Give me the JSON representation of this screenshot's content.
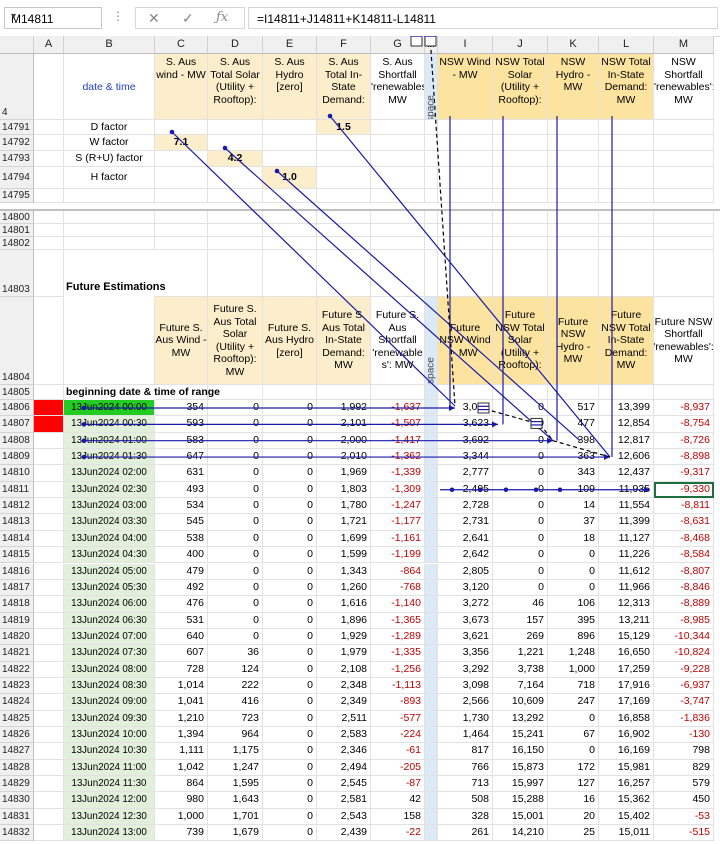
{
  "formula_bar": {
    "name_box": "M14811",
    "formula": "=I14811+J14811+K14811-L14811"
  },
  "columns": [
    "A",
    "B",
    "C",
    "D",
    "E",
    "F",
    "G",
    "H",
    "I",
    "J",
    "K",
    "L",
    "M"
  ],
  "header_row": {
    "row": "4",
    "cells": {
      "B": "date & time",
      "C": "S. Aus wind - MW",
      "D": "S. Aus Total Solar (Utility + Rooftop):",
      "E": "S. Aus Hydro [zero]",
      "F": "S. Aus Total In-State Demand:",
      "G": "S. Aus Shortfall 'renewables': MW",
      "H": "space",
      "I": "NSW Wind - MW",
      "J": "NSW Total Solar (Utility + Rooftop):",
      "K": "NSW Hydro - MW",
      "L": "NSW Total In-State Demand: MW",
      "M": "NSW Shortfall 'renewables': MW"
    }
  },
  "factor_rows": [
    {
      "row": "14791",
      "label": "D factor",
      "value": "1.5",
      "col": "F"
    },
    {
      "row": "14792",
      "label": "W factor",
      "value": "7.1",
      "col": "C"
    },
    {
      "row": "14793",
      "label": "S (R+U) factor",
      "value": "4.2",
      "col": "D"
    },
    {
      "row": "14794",
      "label": "H factor",
      "value": "1.0",
      "col": "E"
    }
  ],
  "blank_rows": [
    "14795",
    "14800",
    "14801",
    "14802"
  ],
  "section_title": {
    "row": "14803",
    "text": "Future Estimations"
  },
  "future_header": {
    "row": "14804",
    "cells": {
      "C": "Future S. Aus Wind - MW",
      "D": "Future S. Aus Total Solar (Utility + Rooftop): MW",
      "E": "Future S. Aus Hydro [zero]",
      "F": "Future S. Aus Total In-State Demand: MW",
      "G": "Future S. Aus Shortfall 'renewable s': MW",
      "H": "space",
      "I": "Future NSW Wind - MW",
      "J": "Future NSW Total Solar (Utility + Rooftop):",
      "K": "Future NSW Hydro - MW",
      "L": "Future NSW Total In-State Demand: MW",
      "M": "Future NSW Shortfall 'renewables': MW"
    }
  },
  "range_label": {
    "row": "14805",
    "text": "beginning date & time of range"
  },
  "data_rows": [
    {
      "row": "14806",
      "dt": "13Jun2024 00:00",
      "c": "354",
      "d": "0",
      "e": "0",
      "f": "1,992",
      "g": "-1,637",
      "i": "3,045",
      "j": "0",
      "k": "517",
      "l": "13,399",
      "m": "-8,937"
    },
    {
      "row": "14807",
      "dt": "13Jun2024 00:30",
      "c": "593",
      "d": "0",
      "e": "0",
      "f": "2,101",
      "g": "-1,507",
      "i": "3,623",
      "j": "0",
      "k": "477",
      "l": "12,854",
      "m": "-8,754"
    },
    {
      "row": "14808",
      "dt": "13Jun2024 01:00",
      "c": "583",
      "d": "0",
      "e": "0",
      "f": "2,000",
      "g": "-1,417",
      "i": "3,692",
      "j": "0",
      "k": "398",
      "l": "12,817",
      "m": "-8,726"
    },
    {
      "row": "14809",
      "dt": "13Jun2024 01:30",
      "c": "647",
      "d": "0",
      "e": "0",
      "f": "2,010",
      "g": "-1,362",
      "i": "3,344",
      "j": "0",
      "k": "363",
      "l": "12,606",
      "m": "-8,898"
    },
    {
      "row": "14810",
      "dt": "13Jun2024 02:00",
      "c": "631",
      "d": "0",
      "e": "0",
      "f": "1,969",
      "g": "-1,339",
      "i": "2,777",
      "j": "0",
      "k": "343",
      "l": "12,437",
      "m": "-9,317"
    },
    {
      "row": "14811",
      "dt": "13Jun2024 02:30",
      "c": "493",
      "d": "0",
      "e": "0",
      "f": "1,803",
      "g": "-1,309",
      "i": "2,495",
      "j": "0",
      "k": "109",
      "l": "11,935",
      "m": "-9,330"
    },
    {
      "row": "14812",
      "dt": "13Jun2024 03:00",
      "c": "534",
      "d": "0",
      "e": "0",
      "f": "1,780",
      "g": "-1,247",
      "i": "2,728",
      "j": "0",
      "k": "14",
      "l": "11,554",
      "m": "-8,811"
    },
    {
      "row": "14813",
      "dt": "13Jun2024 03:30",
      "c": "545",
      "d": "0",
      "e": "0",
      "f": "1,721",
      "g": "-1,177",
      "i": "2,731",
      "j": "0",
      "k": "37",
      "l": "11,399",
      "m": "-8,631"
    },
    {
      "row": "14814",
      "dt": "13Jun2024 04:00",
      "c": "538",
      "d": "0",
      "e": "0",
      "f": "1,699",
      "g": "-1,161",
      "i": "2,641",
      "j": "0",
      "k": "18",
      "l": "11,127",
      "m": "-8,468"
    },
    {
      "row": "14815",
      "dt": "13Jun2024 04:30",
      "c": "400",
      "d": "0",
      "e": "0",
      "f": "1,599",
      "g": "-1,199",
      "i": "2,642",
      "j": "0",
      "k": "0",
      "l": "11,226",
      "m": "-8,584"
    },
    {
      "row": "14816",
      "dt": "13Jun2024 05:00",
      "c": "479",
      "d": "0",
      "e": "0",
      "f": "1,343",
      "g": "-864",
      "i": "2,805",
      "j": "0",
      "k": "0",
      "l": "11,612",
      "m": "-8,807"
    },
    {
      "row": "14817",
      "dt": "13Jun2024 05:30",
      "c": "492",
      "d": "0",
      "e": "0",
      "f": "1,260",
      "g": "-768",
      "i": "3,120",
      "j": "0",
      "k": "0",
      "l": "11,966",
      "m": "-8,846"
    },
    {
      "row": "14818",
      "dt": "13Jun2024 06:00",
      "c": "476",
      "d": "0",
      "e": "0",
      "f": "1,616",
      "g": "-1,140",
      "i": "3,272",
      "j": "46",
      "k": "106",
      "l": "12,313",
      "m": "-8,889"
    },
    {
      "row": "14819",
      "dt": "13Jun2024 06:30",
      "c": "531",
      "d": "0",
      "e": "0",
      "f": "1,896",
      "g": "-1,365",
      "i": "3,673",
      "j": "157",
      "k": "395",
      "l": "13,211",
      "m": "-8,985"
    },
    {
      "row": "14820",
      "dt": "13Jun2024 07:00",
      "c": "640",
      "d": "0",
      "e": "0",
      "f": "1,929",
      "g": "-1,289",
      "i": "3,621",
      "j": "269",
      "k": "896",
      "l": "15,129",
      "m": "-10,344"
    },
    {
      "row": "14821",
      "dt": "13Jun2024 07:30",
      "c": "607",
      "d": "36",
      "e": "0",
      "f": "1,979",
      "g": "-1,335",
      "i": "3,356",
      "j": "1,221",
      "k": "1,248",
      "l": "16,650",
      "m": "-10,824"
    },
    {
      "row": "14822",
      "dt": "13Jun2024 08:00",
      "c": "728",
      "d": "124",
      "e": "0",
      "f": "2,108",
      "g": "-1,256",
      "i": "3,292",
      "j": "3,738",
      "k": "1,000",
      "l": "17,259",
      "m": "-9,228"
    },
    {
      "row": "14823",
      "dt": "13Jun2024 08:30",
      "c": "1,014",
      "d": "222",
      "e": "0",
      "f": "2,348",
      "g": "-1,113",
      "i": "3,098",
      "j": "7,164",
      "k": "718",
      "l": "17,916",
      "m": "-6,937"
    },
    {
      "row": "14824",
      "dt": "13Jun2024 09:00",
      "c": "1,041",
      "d": "416",
      "e": "0",
      "f": "2,349",
      "g": "-893",
      "i": "2,566",
      "j": "10,609",
      "k": "247",
      "l": "17,169",
      "m": "-3,747"
    },
    {
      "row": "14825",
      "dt": "13Jun2024 09:30",
      "c": "1,210",
      "d": "723",
      "e": "0",
      "f": "2,511",
      "g": "-577",
      "i": "1,730",
      "j": "13,292",
      "k": "0",
      "l": "16,858",
      "m": "-1,836"
    },
    {
      "row": "14826",
      "dt": "13Jun2024 10:00",
      "c": "1,394",
      "d": "964",
      "e": "0",
      "f": "2,583",
      "g": "-224",
      "i": "1,464",
      "j": "15,241",
      "k": "67",
      "l": "16,902",
      "m": "-130"
    },
    {
      "row": "14827",
      "dt": "13Jun2024 10:30",
      "c": "1,111",
      "d": "1,175",
      "e": "0",
      "f": "2,346",
      "g": "-61",
      "i": "817",
      "j": "16,150",
      "k": "0",
      "l": "16,169",
      "m": "798"
    },
    {
      "row": "14828",
      "dt": "13Jun2024 11:00",
      "c": "1,042",
      "d": "1,247",
      "e": "0",
      "f": "2,494",
      "g": "-205",
      "i": "766",
      "j": "15,873",
      "k": "172",
      "l": "15,981",
      "m": "829"
    },
    {
      "row": "14829",
      "dt": "13Jun2024 11:30",
      "c": "864",
      "d": "1,595",
      "e": "0",
      "f": "2,545",
      "g": "-87",
      "i": "713",
      "j": "15,997",
      "k": "127",
      "l": "16,257",
      "m": "579"
    },
    {
      "row": "14830",
      "dt": "13Jun2024 12:00",
      "c": "980",
      "d": "1,643",
      "e": "0",
      "f": "2,581",
      "g": "42",
      "i": "508",
      "j": "15,288",
      "k": "16",
      "l": "15,362",
      "m": "450"
    },
    {
      "row": "14831",
      "dt": "13Jun2024 12:30",
      "c": "1,000",
      "d": "1,701",
      "e": "0",
      "f": "2,543",
      "g": "158",
      "i": "328",
      "j": "15,001",
      "k": "20",
      "l": "15,402",
      "m": "-53"
    },
    {
      "row": "14832",
      "dt": "13Jun2024 13:00",
      "c": "739",
      "d": "1,679",
      "e": "0",
      "f": "2,439",
      "g": "-22",
      "i": "261",
      "j": "14,210",
      "k": "25",
      "l": "15,011",
      "m": "-515"
    }
  ]
}
